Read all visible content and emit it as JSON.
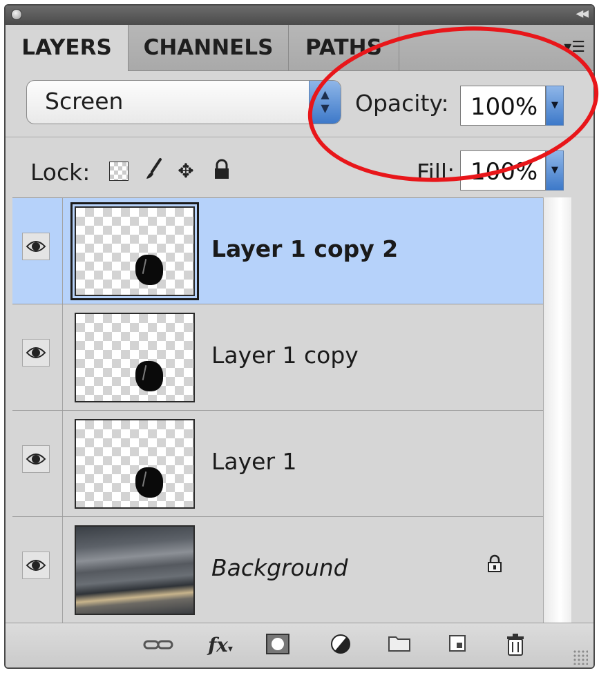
{
  "tabs": [
    {
      "label": "LAYERS",
      "active": true
    },
    {
      "label": "CHANNELS",
      "active": false
    },
    {
      "label": "PATHS",
      "active": false
    }
  ],
  "blend_mode": {
    "value": "Screen"
  },
  "opacity": {
    "label": "Opacity:",
    "value": "100%"
  },
  "lock": {
    "label": "Lock:"
  },
  "fill": {
    "label": "Fill:",
    "value": "100%"
  },
  "layers": [
    {
      "name": "Layer 1 copy 2",
      "selected": true,
      "visible": true
    },
    {
      "name": "Layer 1 copy",
      "selected": false,
      "visible": true
    },
    {
      "name": "Layer 1",
      "selected": false,
      "visible": true
    },
    {
      "name": "Background",
      "selected": false,
      "visible": true,
      "locked": true
    }
  ],
  "bottom_icons": [
    "link-layers-icon",
    "fx-icon",
    "layer-mask-icon",
    "adjustment-layer-icon",
    "new-group-icon",
    "new-layer-icon",
    "trash-icon"
  ],
  "colors": {
    "selection": "#b6d2fa",
    "callout": "#e8161a",
    "accent": "#3d79c9"
  }
}
